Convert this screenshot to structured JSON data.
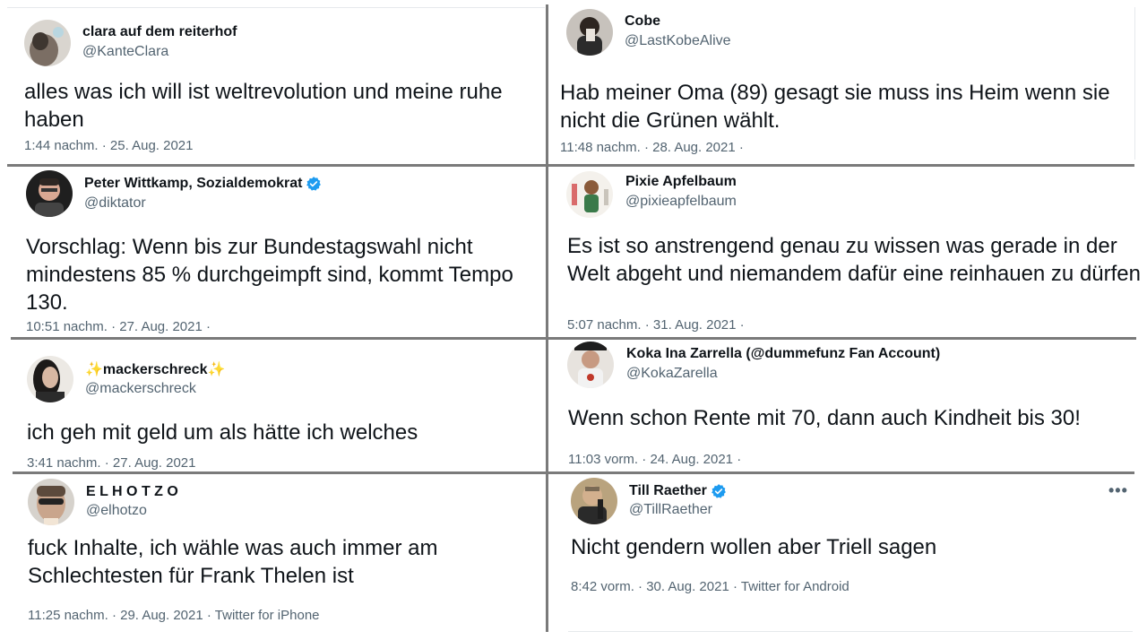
{
  "tweets": [
    {
      "name": "clara auf dem reiterhof",
      "handle": "@KanteClara",
      "text": "alles was ich will ist weltrevolution und meine ruhe haben",
      "time": "1:44 nachm.",
      "date": "25. Aug. 2021",
      "dot_after_date": false,
      "client": ""
    },
    {
      "name": "Cobe",
      "handle": "@LastKobeAlive",
      "text": "Hab meiner Oma (89) gesagt sie muss ins Heim wenn sie nicht die Grünen wählt.",
      "time": "11:48 nachm.",
      "date": "28. Aug. 2021",
      "dot_after_date": true,
      "client": ""
    },
    {
      "name": "Peter Wittkamp, Sozialdemokrat",
      "handle": "@diktator",
      "verified": true,
      "text": "Vorschlag: Wenn bis zur Bundestagswahl nicht mindestens 85 % durchgeimpft sind, kommt Tempo 130.",
      "time": "10:51 nachm.",
      "date": "27. Aug. 2021",
      "dot_after_date": true,
      "client": ""
    },
    {
      "name": "Pixie Apfelbaum",
      "handle": "@pixieapfelbaum",
      "text": "Es ist so anstrengend genau zu wissen was gerade in der Welt abgeht und niemandem dafür eine reinhauen zu dürfen",
      "time": "5:07 nachm.",
      "date": "31. Aug. 2021",
      "dot_after_date": true,
      "client": ""
    },
    {
      "name": "✨mackerschreck✨",
      "handle": "@mackerschreck",
      "text": "ich geh mit geld um als hätte ich welches",
      "time": "3:41 nachm.",
      "date": "27. Aug. 2021",
      "dot_after_date": false,
      "client": ""
    },
    {
      "name": "Koka Ina Zarrella (@dummefunz Fan Account)",
      "handle": "@KokaZarella",
      "text": "Wenn schon Rente mit 70, dann auch Kindheit bis 30!",
      "time": "11:03 vorm.",
      "date": "24. Aug. 2021",
      "dot_after_date": true,
      "client": ""
    },
    {
      "name": "E L H O T Z O",
      "handle": "@elhotzo",
      "text": "fuck Inhalte, ich wähle was auch immer am Schlechtesten für Frank Thelen ist",
      "time": "11:25 nachm.",
      "date": "29. Aug. 2021",
      "dot_after_date": false,
      "client": "Twitter for iPhone"
    },
    {
      "name": "Till Raether",
      "handle": "@TillRaether",
      "verified": true,
      "text": "Nicht gendern wollen aber Triell sagen",
      "time": "8:42 vorm.",
      "date": "30. Aug. 2021",
      "dot_after_date": false,
      "client": "Twitter for Android"
    }
  ],
  "sep": "·",
  "more_label": "•••",
  "colors": {
    "verified": "#1d9bf0",
    "divider": "#7a7a7a",
    "secondary_text": "#536471"
  },
  "icons": {
    "verified": "verified-badge-icon",
    "more": "more-options-icon"
  }
}
